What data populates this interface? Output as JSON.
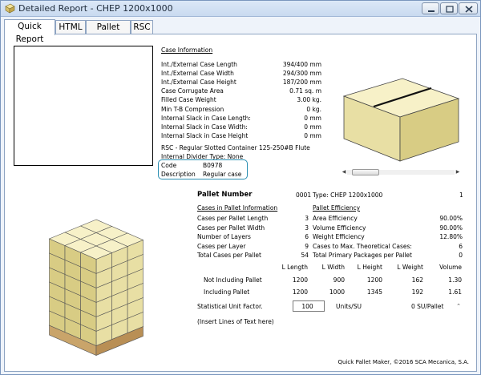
{
  "window": {
    "title": "Detailed Report - CHEP 1200x1000"
  },
  "tabs": [
    {
      "label": "Quick Report"
    },
    {
      "label": "HTML"
    },
    {
      "label": "Pallet Views"
    },
    {
      "label": "RSC"
    }
  ],
  "case_info": {
    "title": "Case Information",
    "rows": [
      {
        "label": "Int./External Case Length",
        "value": "394/400 mm"
      },
      {
        "label": "Int./External Case Width",
        "value": "294/300 mm"
      },
      {
        "label": "Int./External Case Height",
        "value": "187/200 mm"
      },
      {
        "label": "Case Corrugate Area",
        "value": "0.71 sq. m"
      },
      {
        "label": "Filled Case Weight",
        "value": "3.00 kg."
      },
      {
        "label": "Min T-B Compression",
        "value": "0 kg."
      },
      {
        "label": "Internal Slack in Case Length:",
        "value": "0 mm"
      },
      {
        "label": "Internal Slack in Case Width:",
        "value": "0 mm"
      },
      {
        "label": "Internal Slack in Case Height",
        "value": "0 mm"
      }
    ],
    "rsc_line": "RSC - Regular Slotted Container 125-250#B Flute",
    "divider_line": "Internal Divider Type: None",
    "code_label": "Code",
    "code_value": "B0978",
    "desc_label": "Description",
    "desc_value": "Regular case"
  },
  "pallet": {
    "number_label": "Pallet Number",
    "number_value": "0001",
    "type_text": "Type: CHEP 1200x1000",
    "type_count": "1",
    "cases_title": "Cases in Pallet Information",
    "efficiency_title": "Pallet Efficiency",
    "cases_rows": [
      {
        "label": "Cases per Pallet Length",
        "value": "3"
      },
      {
        "label": "Cases per Pallet Width",
        "value": "3"
      },
      {
        "label": "Number of Layers",
        "value": "6"
      },
      {
        "label": "Cases per Layer",
        "value": "9"
      },
      {
        "label": "Total Cases per Pallet",
        "value": "54"
      }
    ],
    "efficiency_rows": [
      {
        "label": "Area Efficiency",
        "value": "90.00%"
      },
      {
        "label": "Volume Efficiency",
        "value": "90.00%"
      },
      {
        "label": "Weight Efficiency",
        "value": "12.80%"
      },
      {
        "label": "Cases to Max. Theoretical Cases:",
        "value": "6"
      },
      {
        "label": "Total Primary Packages per Pallet",
        "value": "0"
      }
    ],
    "dim_headers": [
      "L Length",
      "L Width",
      "L Height",
      "L Weight",
      "Volume"
    ],
    "dim_rows": [
      {
        "label": "Not Including Pallet",
        "values": [
          "1200",
          "900",
          "1200",
          "162",
          "1.30"
        ]
      },
      {
        "label": "Including Pallet",
        "values": [
          "1200",
          "1000",
          "1345",
          "192",
          "1.61"
        ]
      }
    ],
    "su_label": "Statistical Unit Factor.",
    "su_input": "100",
    "su_units": "Units/SU",
    "su_pallet": "0  SU/Pallet",
    "insert_text": "(Insert Lines of Text here)"
  },
  "footer": "Quick Pallet Maker, ©2016 SCA Mecanica, S.A.",
  "colors": {
    "case_face_light": "#f7f1c8",
    "case_face_mid": "#e8dfa4",
    "case_face_dark": "#d8cc84",
    "pallet_wood": "#c9a46a",
    "accent_border": "#2b8fb2"
  }
}
